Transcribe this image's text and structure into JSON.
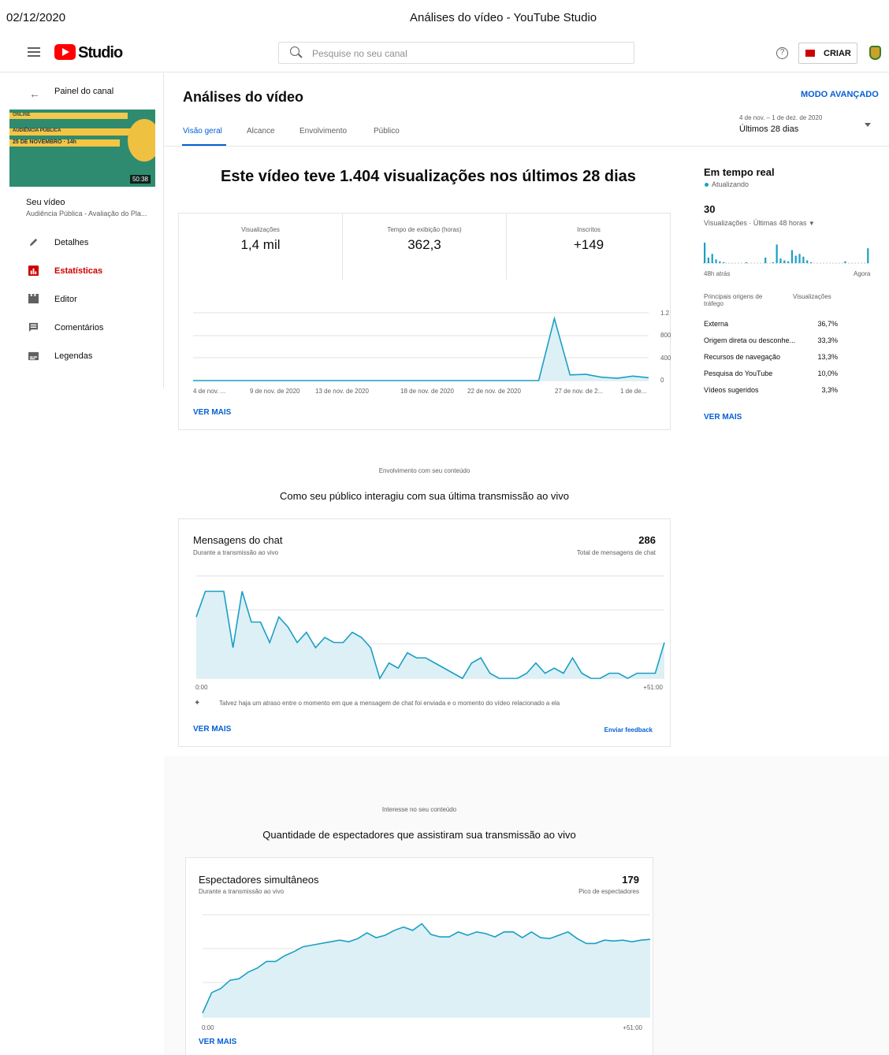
{
  "print_header": {
    "date": "02/12/2020",
    "title": "Análises do vídeo - YouTube Studio"
  },
  "topbar": {
    "studio_label": "Studio",
    "search_placeholder": "Pesquise no seu canal",
    "create_label": "CRIAR",
    "help_glyph": "?"
  },
  "sidebar": {
    "back_label": "Painel do canal",
    "thumb": {
      "line1": "ONLINE",
      "line2": "AUDIÊNCIA PÚBLICA",
      "line3": "25 DE NOVEMBRO · 14h",
      "duration": "50:38"
    },
    "video_heading": "Seu vídeo",
    "video_title": "Audiência Pública - Avaliação do Pla...",
    "items": [
      {
        "label": "Detalhes",
        "icon": "pencil-icon"
      },
      {
        "label": "Estatísticas",
        "icon": "analytics-icon",
        "active": true
      },
      {
        "label": "Editor",
        "icon": "clapper-icon"
      },
      {
        "label": "Comentários",
        "icon": "comment-icon"
      },
      {
        "label": "Legendas",
        "icon": "subtitles-icon"
      }
    ]
  },
  "main": {
    "title": "Análises do vídeo",
    "advanced_mode": "MODO AVANÇADO",
    "tabs": [
      "Visão geral",
      "Alcance",
      "Envolvimento",
      "Público"
    ],
    "date_range_sub": "4 de nov. – 1 de dez. de 2020",
    "date_range": "Últimos 28 dias",
    "headline": "Este vídeo teve 1.404 visualizações nos últimos 28 dias",
    "metrics": [
      {
        "label": "Visualizações",
        "value": "1,4 mil"
      },
      {
        "label": "Tempo de exibição (horas)",
        "value": "362,3"
      },
      {
        "label": "Inscritos",
        "value": "+149"
      }
    ],
    "see_more": "VER MAIS"
  },
  "overview_chart": {
    "x_labels": [
      "4 de nov. ...",
      "9 de nov. de 2020",
      "13 de nov. de 2020",
      "18 de nov. de 2020",
      "22 de nov. de 2020",
      "27 de nov. de 2...",
      "1 de de..."
    ],
    "y_labels": [
      "1.2",
      "800",
      "400",
      "0"
    ]
  },
  "realtime": {
    "title": "Em tempo real",
    "status": "Atualizando",
    "count": "30",
    "subtitle": "Visualizações · Últimas 48 horas",
    "left_label": "48h atrás",
    "right_label": "Agora",
    "sources_header": "Principais origens de tráfego",
    "views_header": "Visualizações",
    "sources": [
      {
        "name": "Externa",
        "value": "36,7%"
      },
      {
        "name": "Origem direta ou desconhe...",
        "value": "33,3%"
      },
      {
        "name": "Recursos de navegação",
        "value": "13,3%"
      },
      {
        "name": "Pesquisa do YouTube",
        "value": "10,0%"
      },
      {
        "name": "Vídeos sugeridos",
        "value": "3,3%"
      }
    ],
    "see_more": "VER MAIS"
  },
  "engagement": {
    "caption": "Envolvimento com seu conteúdo",
    "title": "Como seu público interagiu com sua última transmissão ao vivo",
    "card_title": "Mensagens do chat",
    "card_sub": "Durante a transmissão ao vivo",
    "total": "286",
    "total_label": "Total de mensagens de chat",
    "x_start": "0:00",
    "x_end": "+51:00",
    "note": "Talvez haja um atraso entre o momento em que a mensagem de chat foi enviada e o momento do vídeo relacionado a ela",
    "see_more": "VER MAIS",
    "feedback": "Enviar feedback"
  },
  "interest": {
    "caption": "Interesse no seu conteúdo",
    "title": "Quantidade de espectadores que assistiram sua transmissão ao vivo",
    "card_title": "Espectadores simultâneos",
    "card_sub": "Durante a transmissão ao vivo",
    "peak": "179",
    "peak_label": "Pico de espectadores",
    "x_start": "0:00",
    "x_end": "+51:00",
    "see_more": "VER MAIS"
  },
  "colors": {
    "accent": "#065fd4",
    "line": "#1a9fc4",
    "fill": "#dcf0f6",
    "brand_red": "#ff0000"
  },
  "chart_data": [
    {
      "type": "area",
      "ylim": [
        0,
        1200
      ],
      "values": [
        0,
        0,
        0,
        0,
        0,
        0,
        0,
        0,
        0,
        0,
        0,
        0,
        0,
        0,
        0,
        0,
        0,
        0,
        0,
        0,
        0,
        0,
        0,
        1100,
        100,
        110,
        60,
        40,
        80,
        50
      ]
    },
    {
      "type": "bar",
      "values": [
        22,
        6,
        10,
        4,
        2,
        1,
        0,
        0,
        0,
        0,
        0,
        1,
        0,
        0,
        0,
        0,
        6,
        0,
        1,
        20,
        5,
        3,
        2,
        14,
        8,
        10,
        7,
        3,
        1,
        0,
        0,
        0,
        0,
        0,
        0,
        0,
        0,
        2,
        0,
        0,
        0,
        0,
        0,
        16
      ]
    },
    {
      "type": "area",
      "values": [
        60,
        85,
        85,
        85,
        30,
        85,
        55,
        55,
        35,
        60,
        50,
        35,
        45,
        30,
        40,
        35,
        35,
        45,
        40,
        30,
        0,
        15,
        10,
        25,
        20,
        20,
        15,
        10,
        5,
        0,
        15,
        20,
        5,
        0,
        0,
        0,
        5,
        15,
        5,
        10,
        5,
        20,
        5,
        0,
        0,
        5,
        5,
        0,
        5,
        5,
        5,
        35
      ]
    },
    {
      "type": "area",
      "values": [
        5,
        30,
        35,
        45,
        47,
        55,
        60,
        68,
        68,
        75,
        80,
        86,
        88,
        90,
        92,
        94,
        92,
        96,
        103,
        97,
        100,
        106,
        110,
        106,
        114,
        101,
        98,
        98,
        104,
        100,
        104,
        102,
        98,
        104,
        104,
        97,
        104,
        97,
        96,
        100,
        104,
        96,
        90,
        90,
        94,
        93,
        94,
        92,
        94,
        95
      ]
    }
  ]
}
